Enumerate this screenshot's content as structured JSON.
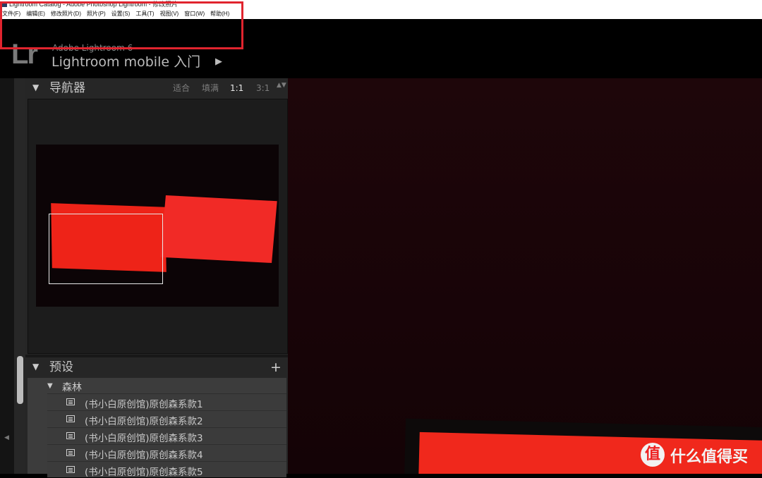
{
  "window": {
    "title": "Lightroom Catalog - Adobe Photoshop Lightroom - 修改照片"
  },
  "menu": {
    "items": [
      "文件(F)",
      "编辑(E)",
      "修改照片(D)",
      "照片(P)",
      "设置(S)",
      "工具(T)",
      "视图(V)",
      "窗口(W)",
      "帮助(H)"
    ]
  },
  "identity": {
    "logo": "Lr",
    "product": "Adobe Lightroom 6",
    "title": "Lightroom mobile 入门",
    "arrow": "▶"
  },
  "navigator": {
    "title": "导航器",
    "collapse_glyph": "▼",
    "modes": [
      "适合",
      "填满",
      "1:1",
      "3:1"
    ],
    "active_mode": "1:1",
    "updown_glyph": "▲▼"
  },
  "presets": {
    "title": "预设",
    "collapse_glyph": "▼",
    "add_glyph": "+",
    "folder": {
      "name": "森林",
      "glyph": "▼",
      "items": [
        "(书小白原创馆)原创森系款1",
        "(书小白原创馆)原创森系款2",
        "(书小白原创馆)原创森系款3",
        "(书小白原创馆)原创森系款4",
        "(书小白原创馆)原创森系款5"
      ]
    }
  },
  "left_edge": {
    "collapse_glyph": "◀"
  },
  "watermark": {
    "badge": "值",
    "text": "什么值得买"
  },
  "colors": {
    "highlight_box": "#e0242e",
    "panel_bg": "#262626",
    "preset_bg": "#3c3c3c",
    "image_red": "#f0281c"
  },
  "icons": {
    "app": "lightroom-app-icon",
    "preset": "preset-list-icon",
    "watermark": "smzdm-badge-icon"
  }
}
